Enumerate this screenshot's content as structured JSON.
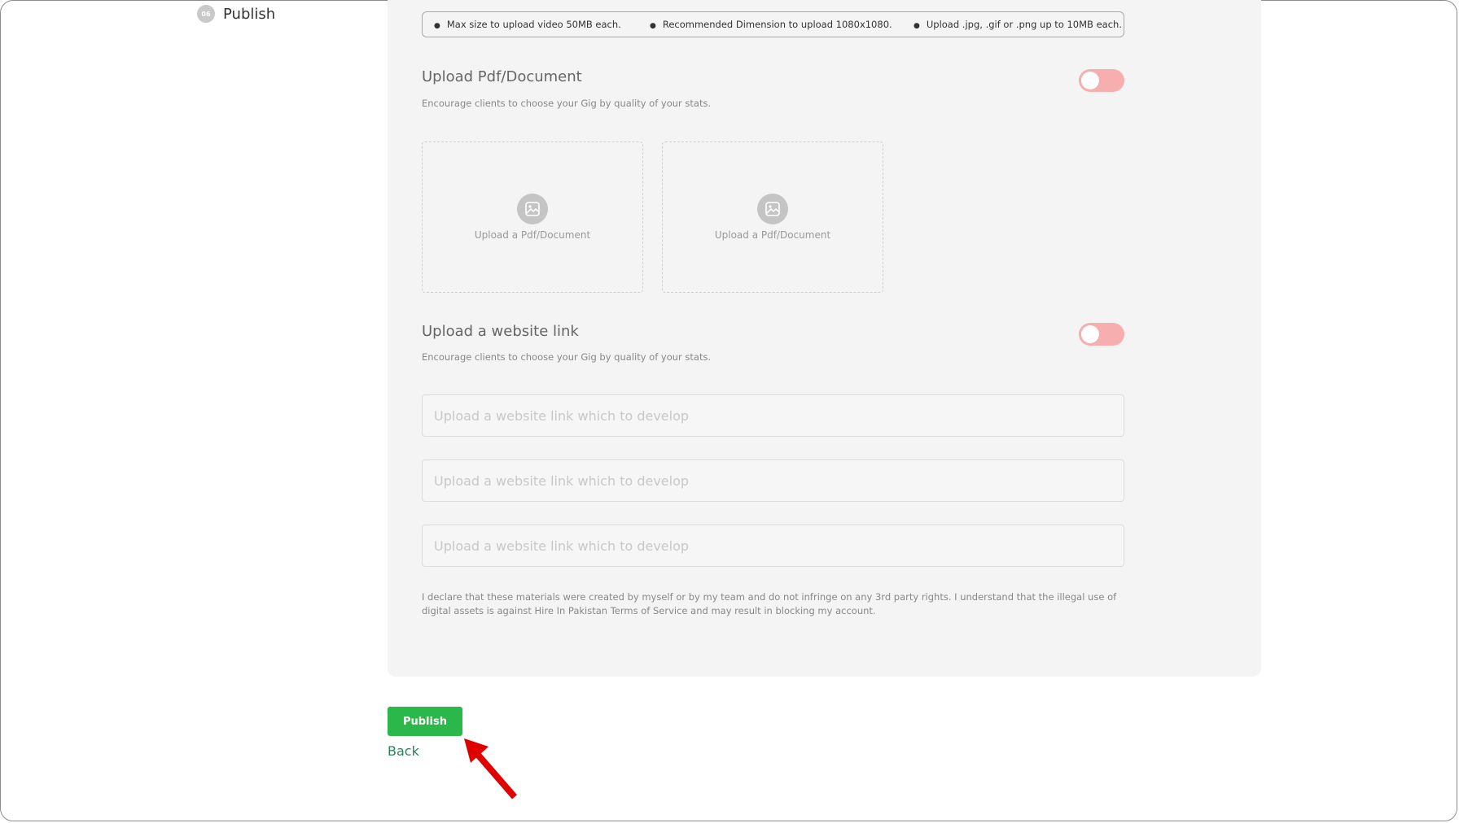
{
  "sidebar": {
    "step_number": "06",
    "step_label": "Publish"
  },
  "notes": {
    "items": [
      "Max size to upload video 50MB each.",
      "Recommended Dimension to upload 1080x1080.",
      "Upload .jpg, .gif or .png up to 10MB each."
    ]
  },
  "pdf_section": {
    "title": "Upload Pdf/Document",
    "description": "Encourage clients to choose your Gig by quality of your stats.",
    "toggle_on": false,
    "boxes": [
      {
        "label": "Upload a Pdf/Document",
        "icon": "image-upload-icon"
      },
      {
        "label": "Upload a Pdf/Document",
        "icon": "image-upload-icon"
      }
    ]
  },
  "link_section": {
    "title": "Upload a website link",
    "description": "Encourage clients to choose your Gig by quality of your stats.",
    "toggle_on": false,
    "inputs": [
      {
        "value": "",
        "placeholder": "Upload a website link which to develop"
      },
      {
        "value": "",
        "placeholder": "Upload a website link which to develop"
      },
      {
        "value": "",
        "placeholder": "Upload a website link which to develop"
      }
    ]
  },
  "declaration": "I declare that these materials were created by myself or by my team and do not infringe on any 3rd party rights. I understand that the illegal use of digital assets is against Hire In Pakistan Terms of Service and may result in blocking my account.",
  "actions": {
    "publish_label": "Publish",
    "back_label": "Back"
  },
  "colors": {
    "accent_green": "#2bb84a",
    "toggle_off_pink": "#f7aeae",
    "back_link": "#2e7d5b",
    "annotation_arrow": "#e00000"
  }
}
